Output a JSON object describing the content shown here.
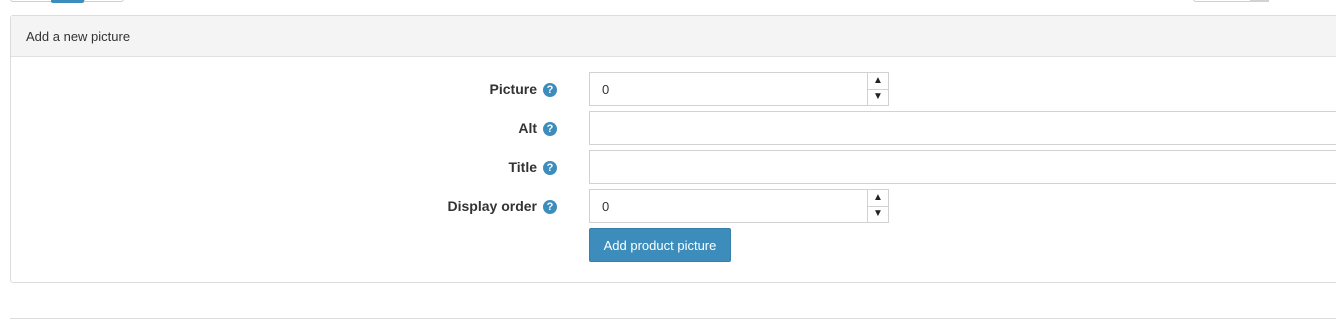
{
  "panel": {
    "title": "Add a new picture"
  },
  "form": {
    "picture": {
      "label": "Picture",
      "help": "?",
      "value": "0"
    },
    "alt": {
      "label": "Alt",
      "help": "?",
      "value": ""
    },
    "title": {
      "label": "Title",
      "help": "?",
      "value": ""
    },
    "display_order": {
      "label": "Display order",
      "help": "?",
      "value": "0"
    },
    "submit_label": "Add product picture"
  },
  "icons": {
    "help": "question-circle-icon",
    "spin_up": "chevron-up-icon",
    "spin_down": "chevron-down-icon"
  },
  "colors": {
    "accent": "#3c8dbc",
    "panel_heading_bg": "#f4f4f4",
    "border": "#d2d2d2"
  }
}
